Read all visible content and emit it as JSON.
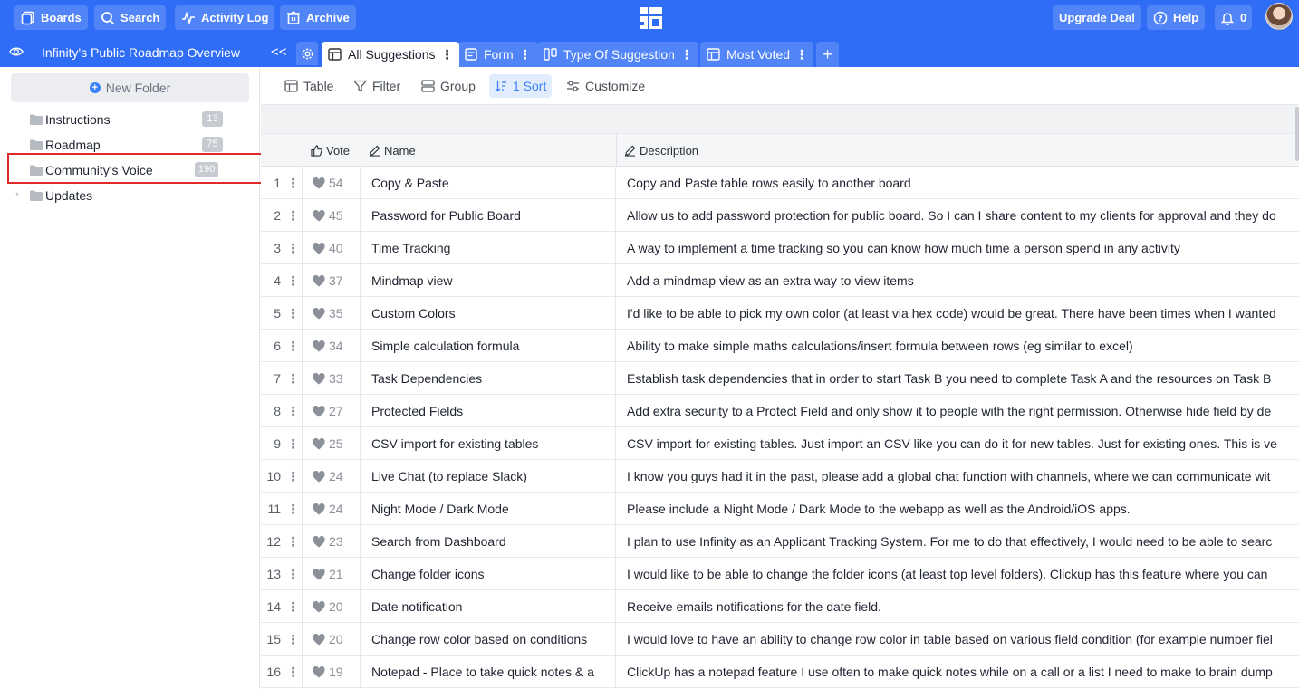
{
  "topbar": {
    "boards": "Boards",
    "search": "Search",
    "activity_log": "Activity Log",
    "archive": "Archive",
    "upgrade": "Upgrade Deal",
    "help": "Help",
    "notifications_count": "0"
  },
  "tabbar": {
    "board_title": "Infinity's Public Roadmap Overview",
    "collapse": "<<",
    "tabs": [
      {
        "label": "All Suggestions"
      },
      {
        "label": "Form"
      },
      {
        "label": "Type Of Suggestion"
      },
      {
        "label": "Most Voted"
      }
    ],
    "add": "+"
  },
  "sidebar": {
    "new_folder": "New Folder",
    "folders": [
      {
        "name": "Instructions",
        "count": "13"
      },
      {
        "name": "Roadmap",
        "count": "75"
      },
      {
        "name": "Community's Voice",
        "count": "190"
      },
      {
        "name": "Updates",
        "count": ""
      }
    ]
  },
  "toolbar": {
    "table": "Table",
    "filter": "Filter",
    "group": "Group",
    "sort": "1 Sort",
    "customize": "Customize"
  },
  "table": {
    "columns": {
      "vote": "Vote",
      "name": "Name",
      "description": "Description"
    },
    "rows": [
      {
        "n": "1",
        "votes": "54",
        "name": "Copy & Paste",
        "desc": "Copy and Paste table rows easily to another board"
      },
      {
        "n": "2",
        "votes": "45",
        "name": "Password for Public Board",
        "desc": "Allow us to add password protection for public board. So I can I share content to my clients for approval and they do"
      },
      {
        "n": "3",
        "votes": "40",
        "name": "Time Tracking",
        "desc": "A way to implement a time tracking so you can know how much time a person spend in any activity"
      },
      {
        "n": "4",
        "votes": "37",
        "name": "Mindmap view",
        "desc": "Add a mindmap view as an extra way to view items"
      },
      {
        "n": "5",
        "votes": "35",
        "name": "Custom Colors",
        "desc": "I'd like to be able to pick my own color (at least via hex code) would be great. There have been times when I wanted"
      },
      {
        "n": "6",
        "votes": "34",
        "name": "Simple calculation formula",
        "desc": "Ability to make simple maths calculations/insert formula between rows (eg similar to excel)"
      },
      {
        "n": "7",
        "votes": "33",
        "name": "Task Dependencies",
        "desc": "Establish task dependencies that in order to start Task B you need to complete Task A and the resources on Task B"
      },
      {
        "n": "8",
        "votes": "27",
        "name": "Protected Fields",
        "desc": "Add extra security to a Protect Field and only show it to people with the right permission. Otherwise hide field by de"
      },
      {
        "n": "9",
        "votes": "25",
        "name": "CSV import for existing tables",
        "desc": "CSV import for existing tables. Just import an CSV like you can do it for new tables. Just for existing ones. This is ve"
      },
      {
        "n": "10",
        "votes": "24",
        "name": "Live Chat (to replace Slack)",
        "desc": "I know you guys had it in the past, please add a global chat function with channels, where we can communicate wit"
      },
      {
        "n": "11",
        "votes": "24",
        "name": "Night Mode / Dark Mode",
        "desc": "Please include a Night Mode / Dark Mode to the webapp as well as the Android/iOS apps."
      },
      {
        "n": "12",
        "votes": "23",
        "name": "Search from Dashboard",
        "desc": "I plan to use Infinity as an Applicant Tracking System. For me to do that effectively, I would need to be able to searc"
      },
      {
        "n": "13",
        "votes": "21",
        "name": "Change folder icons",
        "desc": "I would like to be able to change the folder icons (at least top level folders). Clickup has this feature where you can"
      },
      {
        "n": "14",
        "votes": "20",
        "name": "Date notification",
        "desc": "Receive emails notifications for the date field."
      },
      {
        "n": "15",
        "votes": "20",
        "name": "Change row color based on conditions",
        "desc": "I would love to have an ability to change row color in table based on various field condition (for example number fiel"
      },
      {
        "n": "16",
        "votes": "19",
        "name": "Notepad - Place to take quick notes & a",
        "desc": "ClickUp has a notepad feature I use often to make quick notes while on a call or a list I need to make to brain dump"
      }
    ]
  }
}
